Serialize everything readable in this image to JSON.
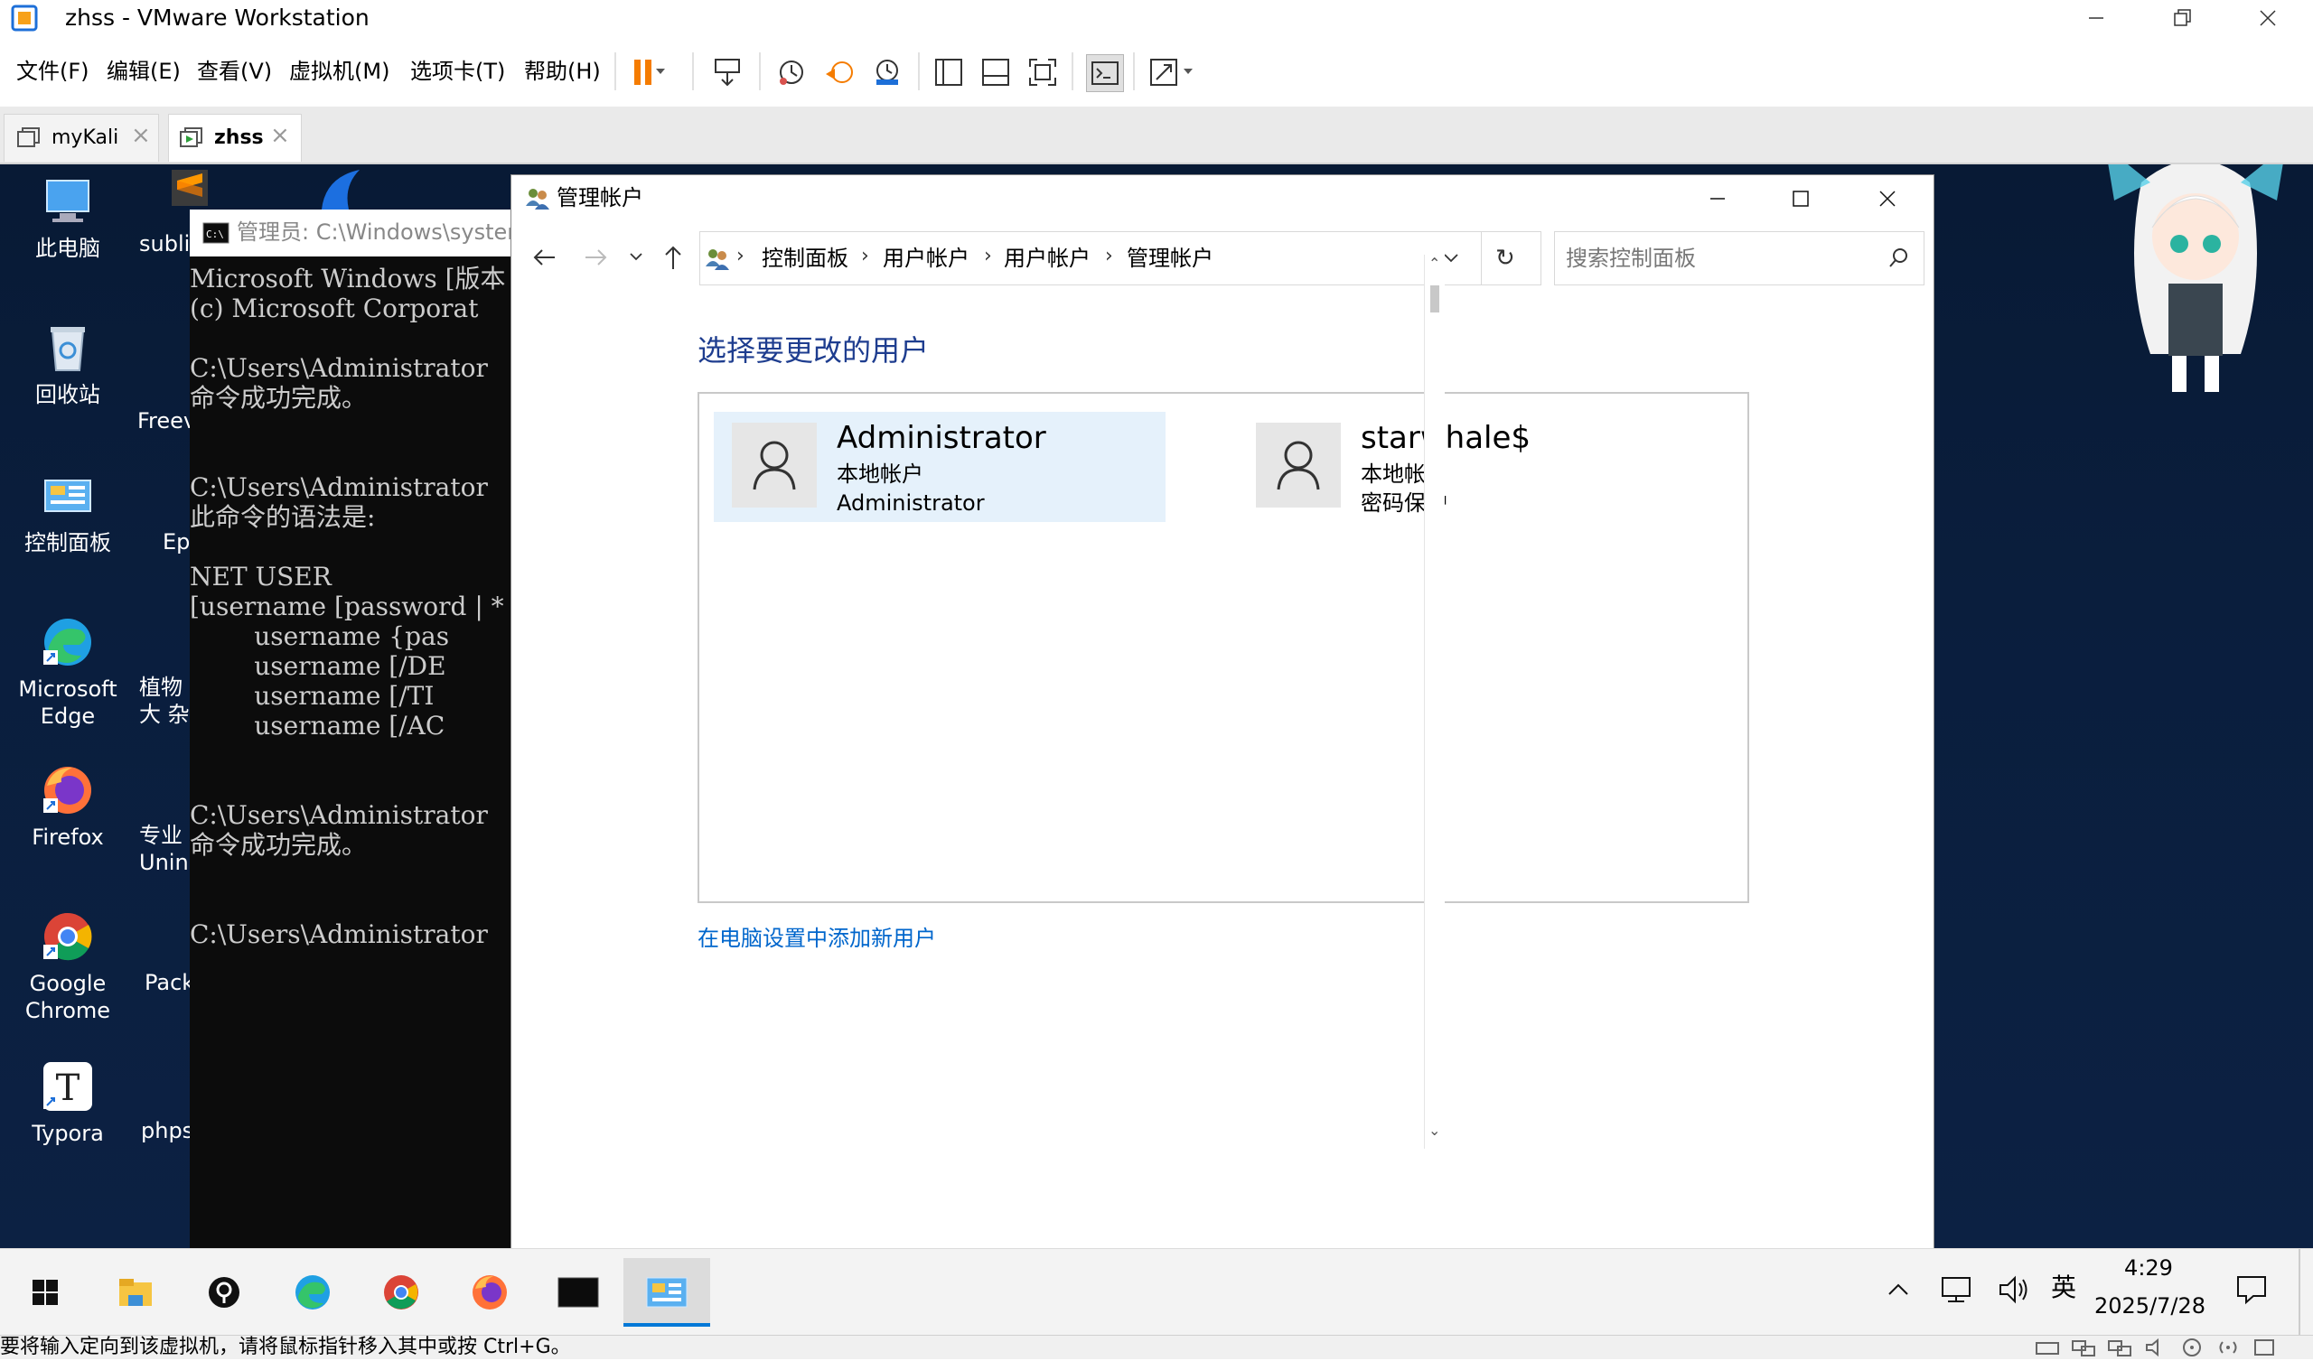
{
  "vm": {
    "window_title": "zhss - VMware Workstation",
    "menu": [
      "文件(F)",
      "编辑(E)",
      "查看(V)",
      "虚拟机(M)",
      "选项卡(T)",
      "帮助(H)"
    ],
    "tabs": [
      {
        "label": "myKali",
        "active": false
      },
      {
        "label": "zhss",
        "active": true
      }
    ],
    "status_message": "要将输入定向到该虚拟机，请将鼠标指针移入其中或按 Ctrl+G。"
  },
  "desktop": {
    "icons_col1": [
      {
        "label": "此电脑",
        "icon": "this-pc-icon"
      },
      {
        "label": "回收站",
        "icon": "recycle-bin-icon"
      },
      {
        "label": "控制面板",
        "icon": "control-panel-icon"
      },
      {
        "label": "Microsoft Edge",
        "icon": "edge-icon"
      },
      {
        "label": "Firefox",
        "icon": "firefox-icon"
      },
      {
        "label": "Google Chrome",
        "icon": "chrome-icon"
      },
      {
        "label": "Typora",
        "icon": "typora-icon"
      }
    ],
    "icons_col2": [
      {
        "label": "subli",
        "icon": "sublime-icon"
      },
      {
        "label": "Freev",
        "icon": "app-icon"
      },
      {
        "label": "Ep",
        "icon": "app-icon"
      },
      {
        "label": "植物大 杂",
        "icon": "app-icon"
      },
      {
        "label": "专业 Unin",
        "icon": "app-icon"
      },
      {
        "label": "Pack",
        "icon": "app-icon"
      },
      {
        "label": "phps",
        "icon": "app-icon"
      }
    ]
  },
  "cmd": {
    "title": "管理员: C:\\Windows\\system",
    "lines": [
      "Microsoft Windows [版本",
      "(c) Microsoft Corporat",
      "",
      "C:\\Users\\Administrator",
      "命令成功完成。",
      "",
      "",
      "C:\\Users\\Administrator",
      "此命令的语法是:",
      "",
      "NET USER",
      "[username [password | *",
      "        username {pas",
      "        username [/DE",
      "        username [/TI",
      "        username [/AC",
      "",
      "",
      "C:\\Users\\Administrator",
      "命令成功完成。",
      "",
      "",
      "C:\\Users\\Administrator"
    ]
  },
  "control_panel": {
    "window_title": "管理帐户",
    "breadcrumb": [
      "控制面板",
      "用户帐户",
      "用户帐户",
      "管理帐户"
    ],
    "search_placeholder": "搜索控制面板",
    "heading": "选择要更改的用户",
    "users": [
      {
        "name": "Administrator",
        "type": "本地帐户",
        "detail": "Administrator",
        "selected": true
      },
      {
        "name": "starwhale$",
        "type": "本地帐户",
        "detail": "密码保护",
        "selected": false
      }
    ],
    "add_user_link": "在电脑设置中添加新用户"
  },
  "taskbar": {
    "apps": [
      "start-icon",
      "file-explorer-icon",
      "pin-app-icon",
      "edge-icon",
      "chrome-icon",
      "firefox-icon",
      "cmd-icon",
      "control-panel-icon"
    ],
    "active_app": "control-panel-icon",
    "ime": "英",
    "time": "4:29",
    "date": "2025/7/28"
  },
  "colors": {
    "accent": "#0078d7",
    "heading_blue": "#1e3d8f",
    "link_blue": "#0066cc",
    "pause_orange": "#f57c00",
    "selected_card": "#e5f1fb",
    "desktop_bg": "#0a1e3d"
  }
}
